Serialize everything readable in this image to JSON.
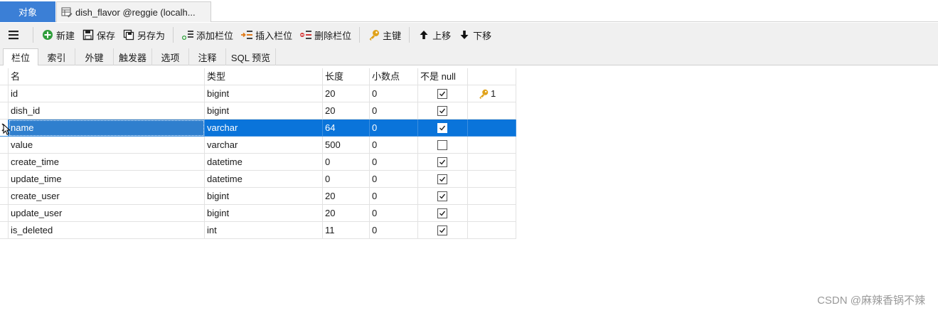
{
  "doc_tabs": {
    "objects_label": "对象",
    "table_tab_label": "dish_flavor @reggie (localh..."
  },
  "toolbar": {
    "new_label": "新建",
    "save_label": "保存",
    "save_as_label": "另存为",
    "add_column_label": "添加栏位",
    "insert_column_label": "插入栏位",
    "delete_column_label": "删除栏位",
    "primary_key_label": "主键",
    "move_up_label": "上移",
    "move_down_label": "下移"
  },
  "sub_tabs": {
    "fields": "栏位",
    "indexes": "索引",
    "foreign_keys": "外键",
    "triggers": "触发器",
    "options": "选项",
    "comment": "注释",
    "sql_preview": "SQL 预览"
  },
  "columns_header": {
    "name": "名",
    "type": "类型",
    "length": "长度",
    "decimals": "小数点",
    "not_null": "不是 null"
  },
  "rows": [
    {
      "name": "id",
      "type": "bigint",
      "length": "20",
      "decimals": "0",
      "not_null": true,
      "key": "1"
    },
    {
      "name": "dish_id",
      "type": "bigint",
      "length": "20",
      "decimals": "0",
      "not_null": true,
      "key": ""
    },
    {
      "name": "name",
      "type": "varchar",
      "length": "64",
      "decimals": "0",
      "not_null": true,
      "key": ""
    },
    {
      "name": "value",
      "type": "varchar",
      "length": "500",
      "decimals": "0",
      "not_null": false,
      "key": ""
    },
    {
      "name": "create_time",
      "type": "datetime",
      "length": "0",
      "decimals": "0",
      "not_null": true,
      "key": ""
    },
    {
      "name": "update_time",
      "type": "datetime",
      "length": "0",
      "decimals": "0",
      "not_null": true,
      "key": ""
    },
    {
      "name": "create_user",
      "type": "bigint",
      "length": "20",
      "decimals": "0",
      "not_null": true,
      "key": ""
    },
    {
      "name": "update_user",
      "type": "bigint",
      "length": "20",
      "decimals": "0",
      "not_null": true,
      "key": ""
    },
    {
      "name": "is_deleted",
      "type": "int",
      "length": "11",
      "decimals": "0",
      "not_null": true,
      "key": ""
    }
  ],
  "selected_row_index": 2,
  "watermark": "CSDN @麻辣香锅不辣",
  "colors": {
    "accent": "#3b7fd6",
    "selection": "#0a74da",
    "key_gold": "#e0a21a"
  }
}
